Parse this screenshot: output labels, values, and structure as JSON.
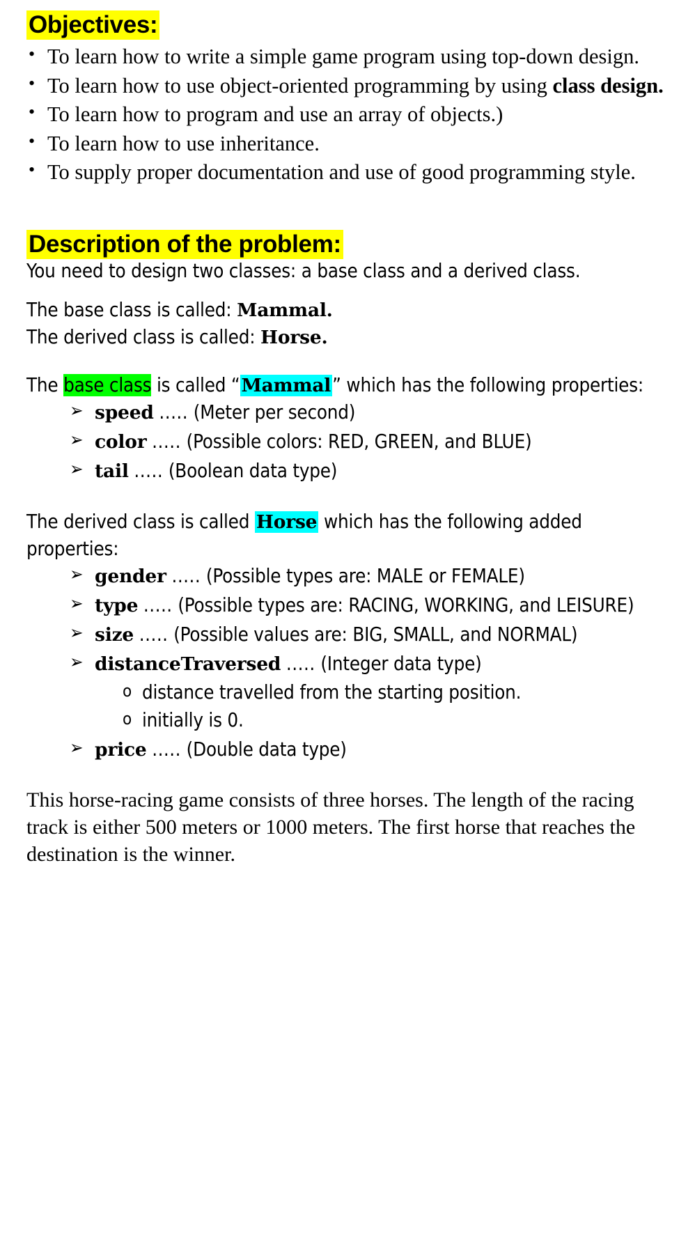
{
  "document": {
    "colors": {
      "highlight_yellow": "#ffff00",
      "highlight_green": "#00ff00",
      "highlight_cyan": "#00ffff",
      "text": "#000000",
      "background": "#ffffff"
    }
  },
  "objectives": {
    "heading": "Objectives:",
    "bullet_marker": "•",
    "items": [
      {
        "text_before": "To learn how to write a simple game program using top-down design.",
        "bold": "",
        "text_after": ""
      },
      {
        "text_before": "To learn how to use object-oriented programming by using ",
        "bold": "class design.",
        "text_after": ""
      },
      {
        "text_before": "To learn how to program and use an array of objects.)",
        "bold": "",
        "text_after": ""
      },
      {
        "text_before": "To learn how to use inheritance.",
        "bold": "",
        "text_after": ""
      },
      {
        "text_before": "To supply proper documentation and use of good programming style.",
        "bold": "",
        "text_after": ""
      }
    ]
  },
  "description": {
    "heading": "Description of the problem:",
    "intro": "You need to design two classes: a base class and a derived class.",
    "base_class_line": {
      "prefix": "The base class is called: ",
      "name": "Mammal."
    },
    "derived_class_line": {
      "prefix": "The derived class is called: ",
      "name": "Horse."
    },
    "base_class_intro": {
      "part1": "The ",
      "highlighted_green": "base class",
      "part2": " is called “",
      "highlighted_cyan": "Mammal",
      "part3": "” which has the following properties:"
    },
    "base_properties": {
      "arrow_marker": "➢",
      "dots": ".....",
      "items": [
        {
          "name": "speed",
          "desc": "(Meter per second)"
        },
        {
          "name": "color",
          "desc": "(Possible colors:  RED, GREEN, and BLUE)"
        },
        {
          "name": "tail",
          "desc": "(Boolean data type)"
        }
      ]
    },
    "derived_class_intro": {
      "part1": "The derived class is called ",
      "highlighted_cyan": "Horse",
      "part2": " which has the following added properties:"
    },
    "derived_properties": {
      "arrow_marker": "➢",
      "sub_marker": "o",
      "dots": ".....",
      "items": [
        {
          "name": "gender",
          "desc": "(Possible types are: MALE or FEMALE)",
          "sub_items": []
        },
        {
          "name": "type",
          "desc": "(Possible types are: RACING, WORKING, and LEISURE)",
          "sub_items": []
        },
        {
          "name": "size",
          "desc": "(Possible values are: BIG, SMALL, and NORMAL)",
          "sub_items": []
        },
        {
          "name": "distanceTraversed",
          "desc": "(Integer data type)",
          "sub_items": [
            "distance travelled from the starting position.",
            "initially is 0."
          ]
        },
        {
          "name": "price",
          "desc": "(Double data type)",
          "sub_items": []
        }
      ]
    },
    "closing_paragraph": "This horse-racing game consists of three horses. The length of the racing track is either 500 meters or 1000 meters.  The first horse that reaches the destination is the winner."
  }
}
